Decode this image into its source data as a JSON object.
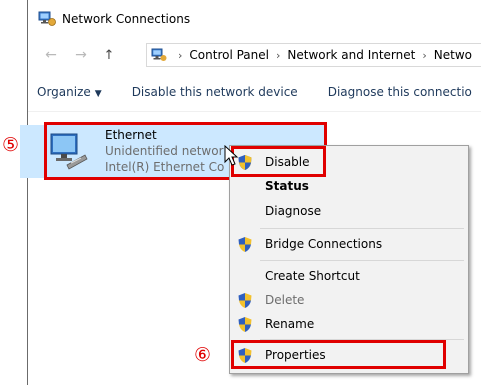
{
  "window": {
    "title": "Network Connections"
  },
  "nav": {
    "back_icon": "back-arrow-icon",
    "forward_icon": "forward-arrow-icon",
    "up_icon": "up-arrow-icon",
    "breadcrumbs": [
      "Control Panel",
      "Network and Internet",
      "Netwo"
    ]
  },
  "toolbar": {
    "organize_label": "Organize",
    "disable_device_label": "Disable this network device",
    "diagnose_label": "Diagnose this connectio"
  },
  "adapter": {
    "name": "Ethernet",
    "status": "Unidentified networ",
    "device": "Intel(R) Ethernet Co"
  },
  "context_menu": {
    "items": [
      {
        "label": "Disable",
        "shield": true,
        "bold": false,
        "disabled": false
      },
      {
        "label": "Status",
        "shield": false,
        "bold": true,
        "disabled": false
      },
      {
        "label": "Diagnose",
        "shield": false,
        "bold": false,
        "disabled": false
      },
      {
        "label": "Bridge Connections",
        "shield": true,
        "bold": false,
        "disabled": false
      },
      {
        "label": "Create Shortcut",
        "shield": false,
        "bold": false,
        "disabled": false
      },
      {
        "label": "Delete",
        "shield": true,
        "bold": false,
        "disabled": true
      },
      {
        "label": "Rename",
        "shield": true,
        "bold": false,
        "disabled": false
      },
      {
        "label": "Properties",
        "shield": true,
        "bold": false,
        "disabled": false
      }
    ]
  },
  "annotations": {
    "step5": "⑤",
    "step6": "⑥"
  },
  "colors": {
    "selection": "#cce8ff",
    "annotation_red": "#e00000",
    "menu_bg": "#f2f2f2",
    "link_text": "#1e395b"
  }
}
